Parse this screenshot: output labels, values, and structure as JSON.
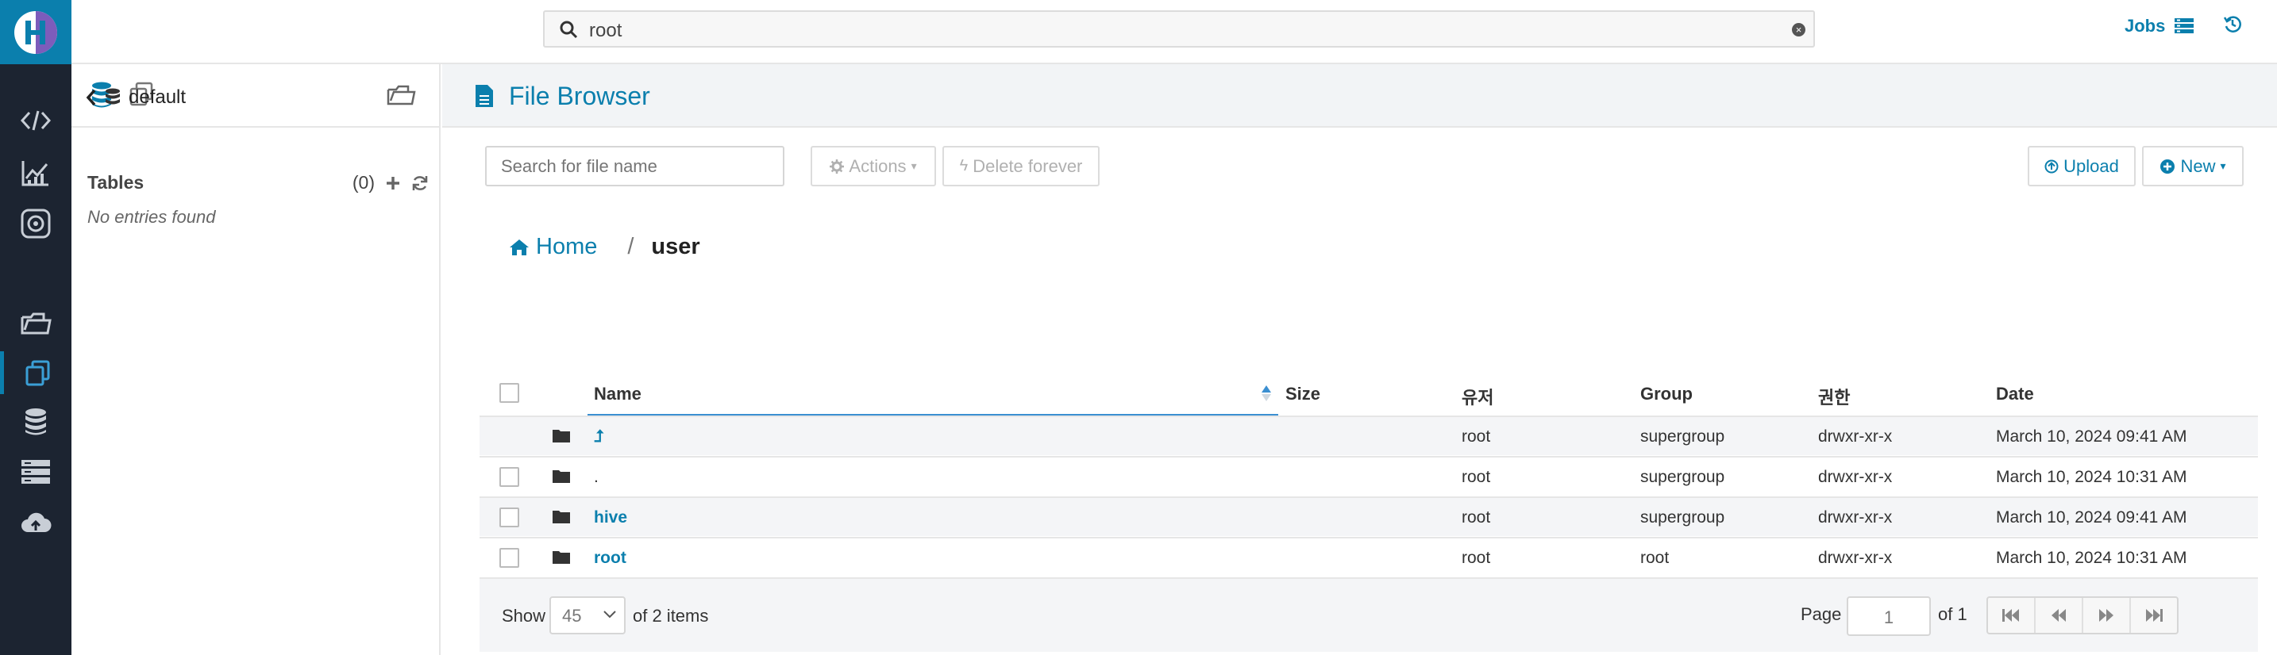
{
  "search": {
    "query": "root"
  },
  "header": {
    "jobs_label": "Jobs"
  },
  "left_panel": {
    "database": "default",
    "tables_label": "Tables",
    "tables_count": "(0)",
    "empty_text": "No entries found"
  },
  "main": {
    "title": "File Browser",
    "file_search_placeholder": "Search for file name",
    "actions_label": "Actions",
    "delete_label": "Delete forever",
    "upload_label": "Upload",
    "new_label": "New",
    "breadcrumb": {
      "home": "Home",
      "separator": "/",
      "current": "user"
    }
  },
  "table": {
    "columns": [
      "Name",
      "Size",
      "유저",
      "Group",
      "권한",
      "Date"
    ],
    "rows": [
      {
        "name": "⮥",
        "size": "",
        "user": "root",
        "group": "supergroup",
        "perm": "drwxr-xr-x",
        "date": "March 10, 2024 09:41 AM"
      },
      {
        "name": ".",
        "size": "",
        "user": "root",
        "group": "supergroup",
        "perm": "drwxr-xr-x",
        "date": "March 10, 2024 10:31 AM"
      },
      {
        "name": "hive",
        "size": "",
        "user": "root",
        "group": "supergroup",
        "perm": "drwxr-xr-x",
        "date": "March 10, 2024 09:41 AM"
      },
      {
        "name": "root",
        "size": "",
        "user": "root",
        "group": "root",
        "perm": "drwxr-xr-x",
        "date": "March 10, 2024 10:31 AM"
      }
    ]
  },
  "pager": {
    "show_label": "Show",
    "page_size": "45",
    "items_text": "of 2 items",
    "page_label": "Page",
    "page_value": "1",
    "of_pages": "of 1"
  },
  "colors": {
    "accent": "#0b7fad",
    "rail": "#1c2431"
  }
}
